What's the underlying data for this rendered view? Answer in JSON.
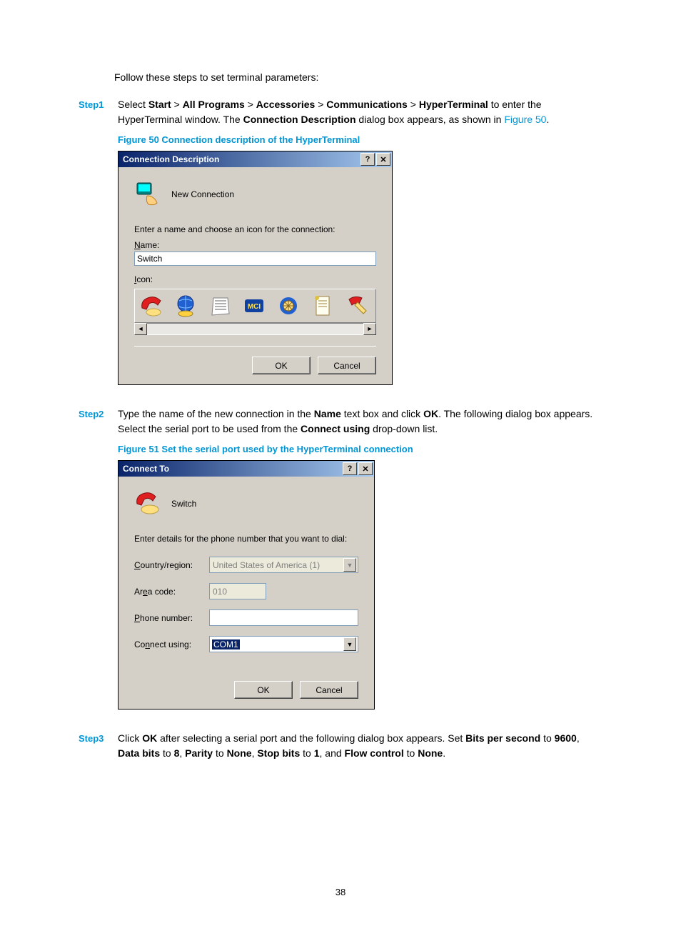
{
  "intro": "Follow these steps to set terminal parameters:",
  "steps": {
    "s1": {
      "label": "Step1",
      "t1": "Select ",
      "b1": "Start",
      "gt": " > ",
      "b2": "All Programs",
      "b3": "Accessories",
      "b4": "Communications",
      "b5": "HyperTerminal",
      "t2": " to enter the HyperTerminal window. The ",
      "b6": "Connection Description",
      "t3": " dialog box appears, as shown in ",
      "link": "Figure 50",
      "dot": "."
    },
    "s2": {
      "label": "Step2",
      "t1": "Type the name of the new connection in the ",
      "b1": "Name",
      "t2": " text box and click ",
      "b2": "OK",
      "t3": ". The following dialog box appears. Select the serial port to be used from the ",
      "b3": "Connect using",
      "t4": " drop-down list."
    },
    "s3": {
      "label": "Step3",
      "t1": "Click ",
      "b1": "OK",
      "t2": " after selecting a serial port and the following dialog box appears. Set ",
      "b2": "Bits per second",
      "t3": " to ",
      "b3": "9600",
      "t4": ", ",
      "b4": "Data bits",
      "t5": " to ",
      "b5": "8",
      "t6": ", ",
      "b6": "Parity",
      "t7": " to ",
      "b7": "None",
      "t8": ", ",
      "b8": "Stop bits",
      "t9": " to ",
      "b9": "1",
      "t10": ", and ",
      "b10": "Flow control",
      "t11": " to ",
      "b11": "None",
      "t12": "."
    }
  },
  "fig50_caption": "Figure 50 Connection description of the HyperTerminal",
  "fig51_caption": "Figure 51 Set the serial port used by the HyperTerminal connection",
  "dlg1": {
    "title": "Connection Description",
    "hdr": "New Connection",
    "prompt": "Enter a name and choose an icon for the connection:",
    "name_label": "ame:",
    "name_u": "N",
    "name_value": "Switch",
    "icon_label": "con:",
    "icon_u": "I",
    "ok": "OK",
    "cancel": "Cancel"
  },
  "dlg2": {
    "title": "Connect To",
    "hdr": "Switch",
    "prompt": "Enter details for the phone number that you want to dial:",
    "country_label_u": "C",
    "country_label": "ountry/region:",
    "country_val": "United States of America (1)",
    "area_label1": "Ar",
    "area_label_u": "e",
    "area_label2": "a code:",
    "area_val": "010",
    "phone_label_u": "P",
    "phone_label": "hone number:",
    "connect_label1": "Co",
    "connect_label_u": "n",
    "connect_label2": "nect using:",
    "connect_val": "COM1",
    "ok": "OK",
    "cancel": "Cancel"
  },
  "page_num": "38"
}
